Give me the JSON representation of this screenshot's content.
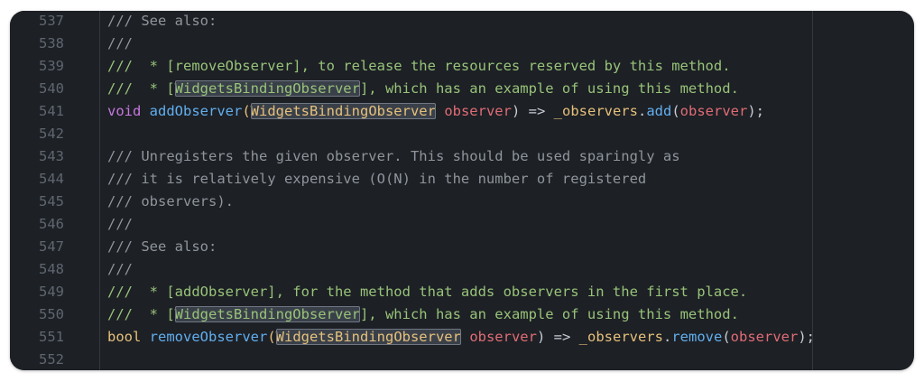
{
  "editor": {
    "colors": {
      "background": "#1d2025",
      "line_number": "#5f6670",
      "comment": "#8f959c",
      "doc_comment": "#98c379",
      "keyword": "#c678dd",
      "function": "#61afef",
      "type": "#e5c07b",
      "param": "#e06c75",
      "default": "#c7ccd4",
      "highlight_box": "#3a4049"
    },
    "lines": [
      {
        "number": "537",
        "tokens": [
          {
            "t": "/// See also:",
            "c": "comment"
          }
        ]
      },
      {
        "number": "538",
        "tokens": [
          {
            "t": "///",
            "c": "comment"
          }
        ]
      },
      {
        "number": "539",
        "tokens": [
          {
            "t": "///  * [removeObserver], to release the resources reserved by this method.",
            "c": "doc_comment"
          }
        ]
      },
      {
        "number": "540",
        "tokens": [
          {
            "t": "///  * [",
            "c": "doc_comment"
          },
          {
            "t": "WidgetsBindingObserver",
            "c": "doc_comment",
            "hl": true
          },
          {
            "t": "], which has an example of using this method.",
            "c": "doc_comment"
          }
        ]
      },
      {
        "number": "541",
        "tokens": [
          {
            "t": "void ",
            "c": "keyword"
          },
          {
            "t": "addObserver",
            "c": "function"
          },
          {
            "t": "(",
            "c": "type"
          },
          {
            "t": "WidgetsBindingObserver",
            "c": "type",
            "hl": true
          },
          {
            "t": " observer",
            "c": "param"
          },
          {
            "t": ") => ",
            "c": "default"
          },
          {
            "t": "_observers",
            "c": "type"
          },
          {
            "t": ".",
            "c": "default"
          },
          {
            "t": "add",
            "c": "function"
          },
          {
            "t": "(",
            "c": "default"
          },
          {
            "t": "observer",
            "c": "param"
          },
          {
            "t": ");",
            "c": "default"
          }
        ]
      },
      {
        "number": "542",
        "tokens": []
      },
      {
        "number": "543",
        "tokens": [
          {
            "t": "/// Unregisters the given observer. This should be used sparingly as",
            "c": "comment"
          }
        ]
      },
      {
        "number": "544",
        "tokens": [
          {
            "t": "/// it is relatively expensive (O(N) in the number of registered",
            "c": "comment"
          }
        ]
      },
      {
        "number": "545",
        "tokens": [
          {
            "t": "/// observers).",
            "c": "comment"
          }
        ]
      },
      {
        "number": "546",
        "tokens": [
          {
            "t": "///",
            "c": "comment"
          }
        ]
      },
      {
        "number": "547",
        "tokens": [
          {
            "t": "/// See also:",
            "c": "comment"
          }
        ]
      },
      {
        "number": "548",
        "tokens": [
          {
            "t": "///",
            "c": "comment"
          }
        ]
      },
      {
        "number": "549",
        "tokens": [
          {
            "t": "///  * [addObserver], for the method that adds observers in the first place.",
            "c": "doc_comment"
          }
        ]
      },
      {
        "number": "550",
        "tokens": [
          {
            "t": "///  * [",
            "c": "doc_comment"
          },
          {
            "t": "WidgetsBindingObserver",
            "c": "doc_comment",
            "hl": true
          },
          {
            "t": "], which has an example of using this method.",
            "c": "doc_comment"
          }
        ]
      },
      {
        "number": "551",
        "tokens": [
          {
            "t": "bool ",
            "c": "type"
          },
          {
            "t": "removeObserver",
            "c": "function"
          },
          {
            "t": "(",
            "c": "type"
          },
          {
            "t": "WidgetsBindingObserver",
            "c": "type",
            "hl": true
          },
          {
            "t": " observer",
            "c": "param"
          },
          {
            "t": ") => ",
            "c": "default"
          },
          {
            "t": "_observers",
            "c": "type"
          },
          {
            "t": ".",
            "c": "default"
          },
          {
            "t": "remove",
            "c": "function"
          },
          {
            "t": "(",
            "c": "default"
          },
          {
            "t": "observer",
            "c": "param"
          },
          {
            "t": ");",
            "c": "default"
          }
        ]
      },
      {
        "number": "552",
        "tokens": []
      }
    ]
  }
}
